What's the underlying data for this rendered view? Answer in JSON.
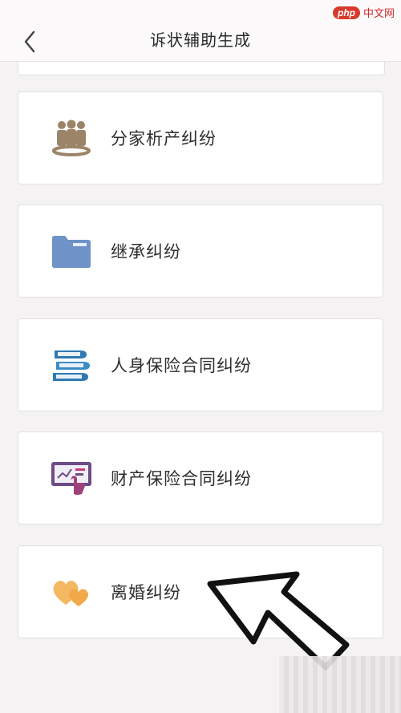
{
  "header": {
    "title": "诉状辅助生成",
    "back_icon": "chevron-left-icon"
  },
  "watermark": {
    "badge": "php",
    "text": "中文网"
  },
  "items": [
    {
      "label": "分家析产纠纷",
      "icon": "family-group-icon",
      "color": "#a08a70"
    },
    {
      "label": "继承纠纷",
      "icon": "folder-icon",
      "color": "#6f92c8"
    },
    {
      "label": "人身保险合同纠纷",
      "icon": "books-icon",
      "color": "#3f86b8"
    },
    {
      "label": "财产保险合同纠纷",
      "icon": "tablet-chart-icon",
      "color": "#6c4c86"
    },
    {
      "label": "离婚纠纷",
      "icon": "hearts-icon",
      "color": "#f1b15a"
    }
  ]
}
